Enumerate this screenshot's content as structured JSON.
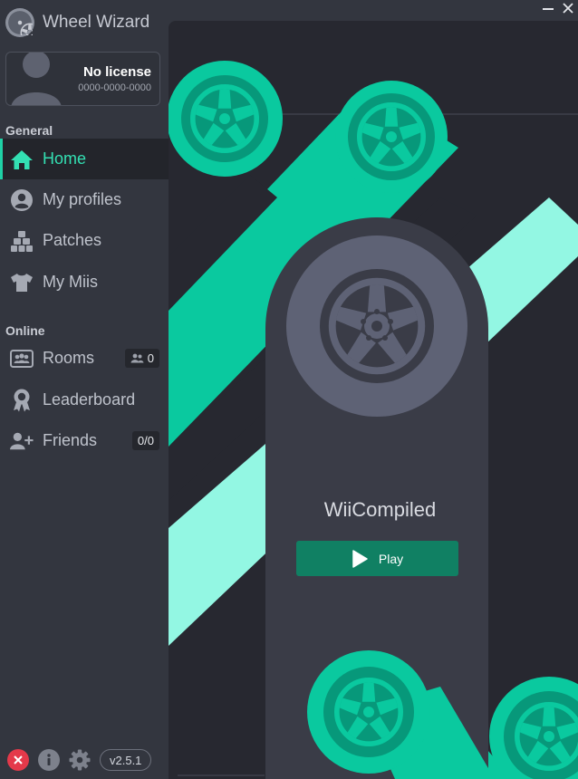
{
  "app": {
    "title": "Wheel Wizard",
    "version": "v2.5.1"
  },
  "license": {
    "name": "No license",
    "code": "0000-0000-0000"
  },
  "sidebar": {
    "general_title": "General",
    "online_title": "Online",
    "general_items": [
      {
        "label": "Home",
        "icon": "home-icon",
        "active": true
      },
      {
        "label": "My profiles",
        "icon": "user-circle-icon"
      },
      {
        "label": "Patches",
        "icon": "boxes-icon"
      },
      {
        "label": "My Miis",
        "icon": "tshirt-icon"
      }
    ],
    "online_items": [
      {
        "label": "Rooms",
        "icon": "rooms-icon",
        "badge": "0"
      },
      {
        "label": "Leaderboard",
        "icon": "award-icon"
      },
      {
        "label": "Friends",
        "icon": "add-user-icon",
        "badge": "0/0"
      }
    ]
  },
  "game": {
    "title": "WiiCompiled",
    "play_label": "Play"
  },
  "colors": {
    "accent": "#1fd1a6",
    "accent_text": "#33e0b3",
    "play_button": "#108063",
    "sidebar_bg": "#33363f",
    "main_bg": "#272830",
    "close_red": "#e4394a"
  }
}
